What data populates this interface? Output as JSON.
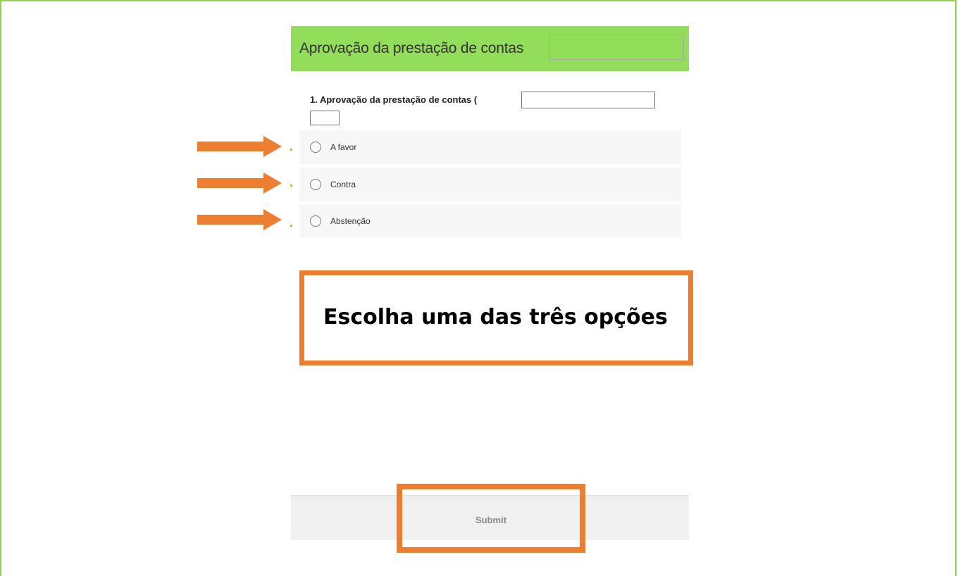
{
  "form": {
    "title": "Aprovação da prestação de contas",
    "question": {
      "label": "1. Aprovação da prestação de contas",
      "open_paren": "(",
      "options": [
        {
          "label": "A favor",
          "selected": false
        },
        {
          "label": "Contra",
          "selected": false
        },
        {
          "label": "Abstenção",
          "selected": false
        }
      ]
    },
    "submit_label": "Submit"
  },
  "annotation": {
    "callout_text": "Escolha uma das três opções",
    "accent_color": "#ed7d31"
  },
  "colors": {
    "header_bg": "#92dd5a",
    "frame_border": "#92d050",
    "option_bg": "#f7f7f7"
  },
  "icons": {
    "arrow": "arrow-right-icon",
    "radio": "radio-unchecked-icon"
  }
}
